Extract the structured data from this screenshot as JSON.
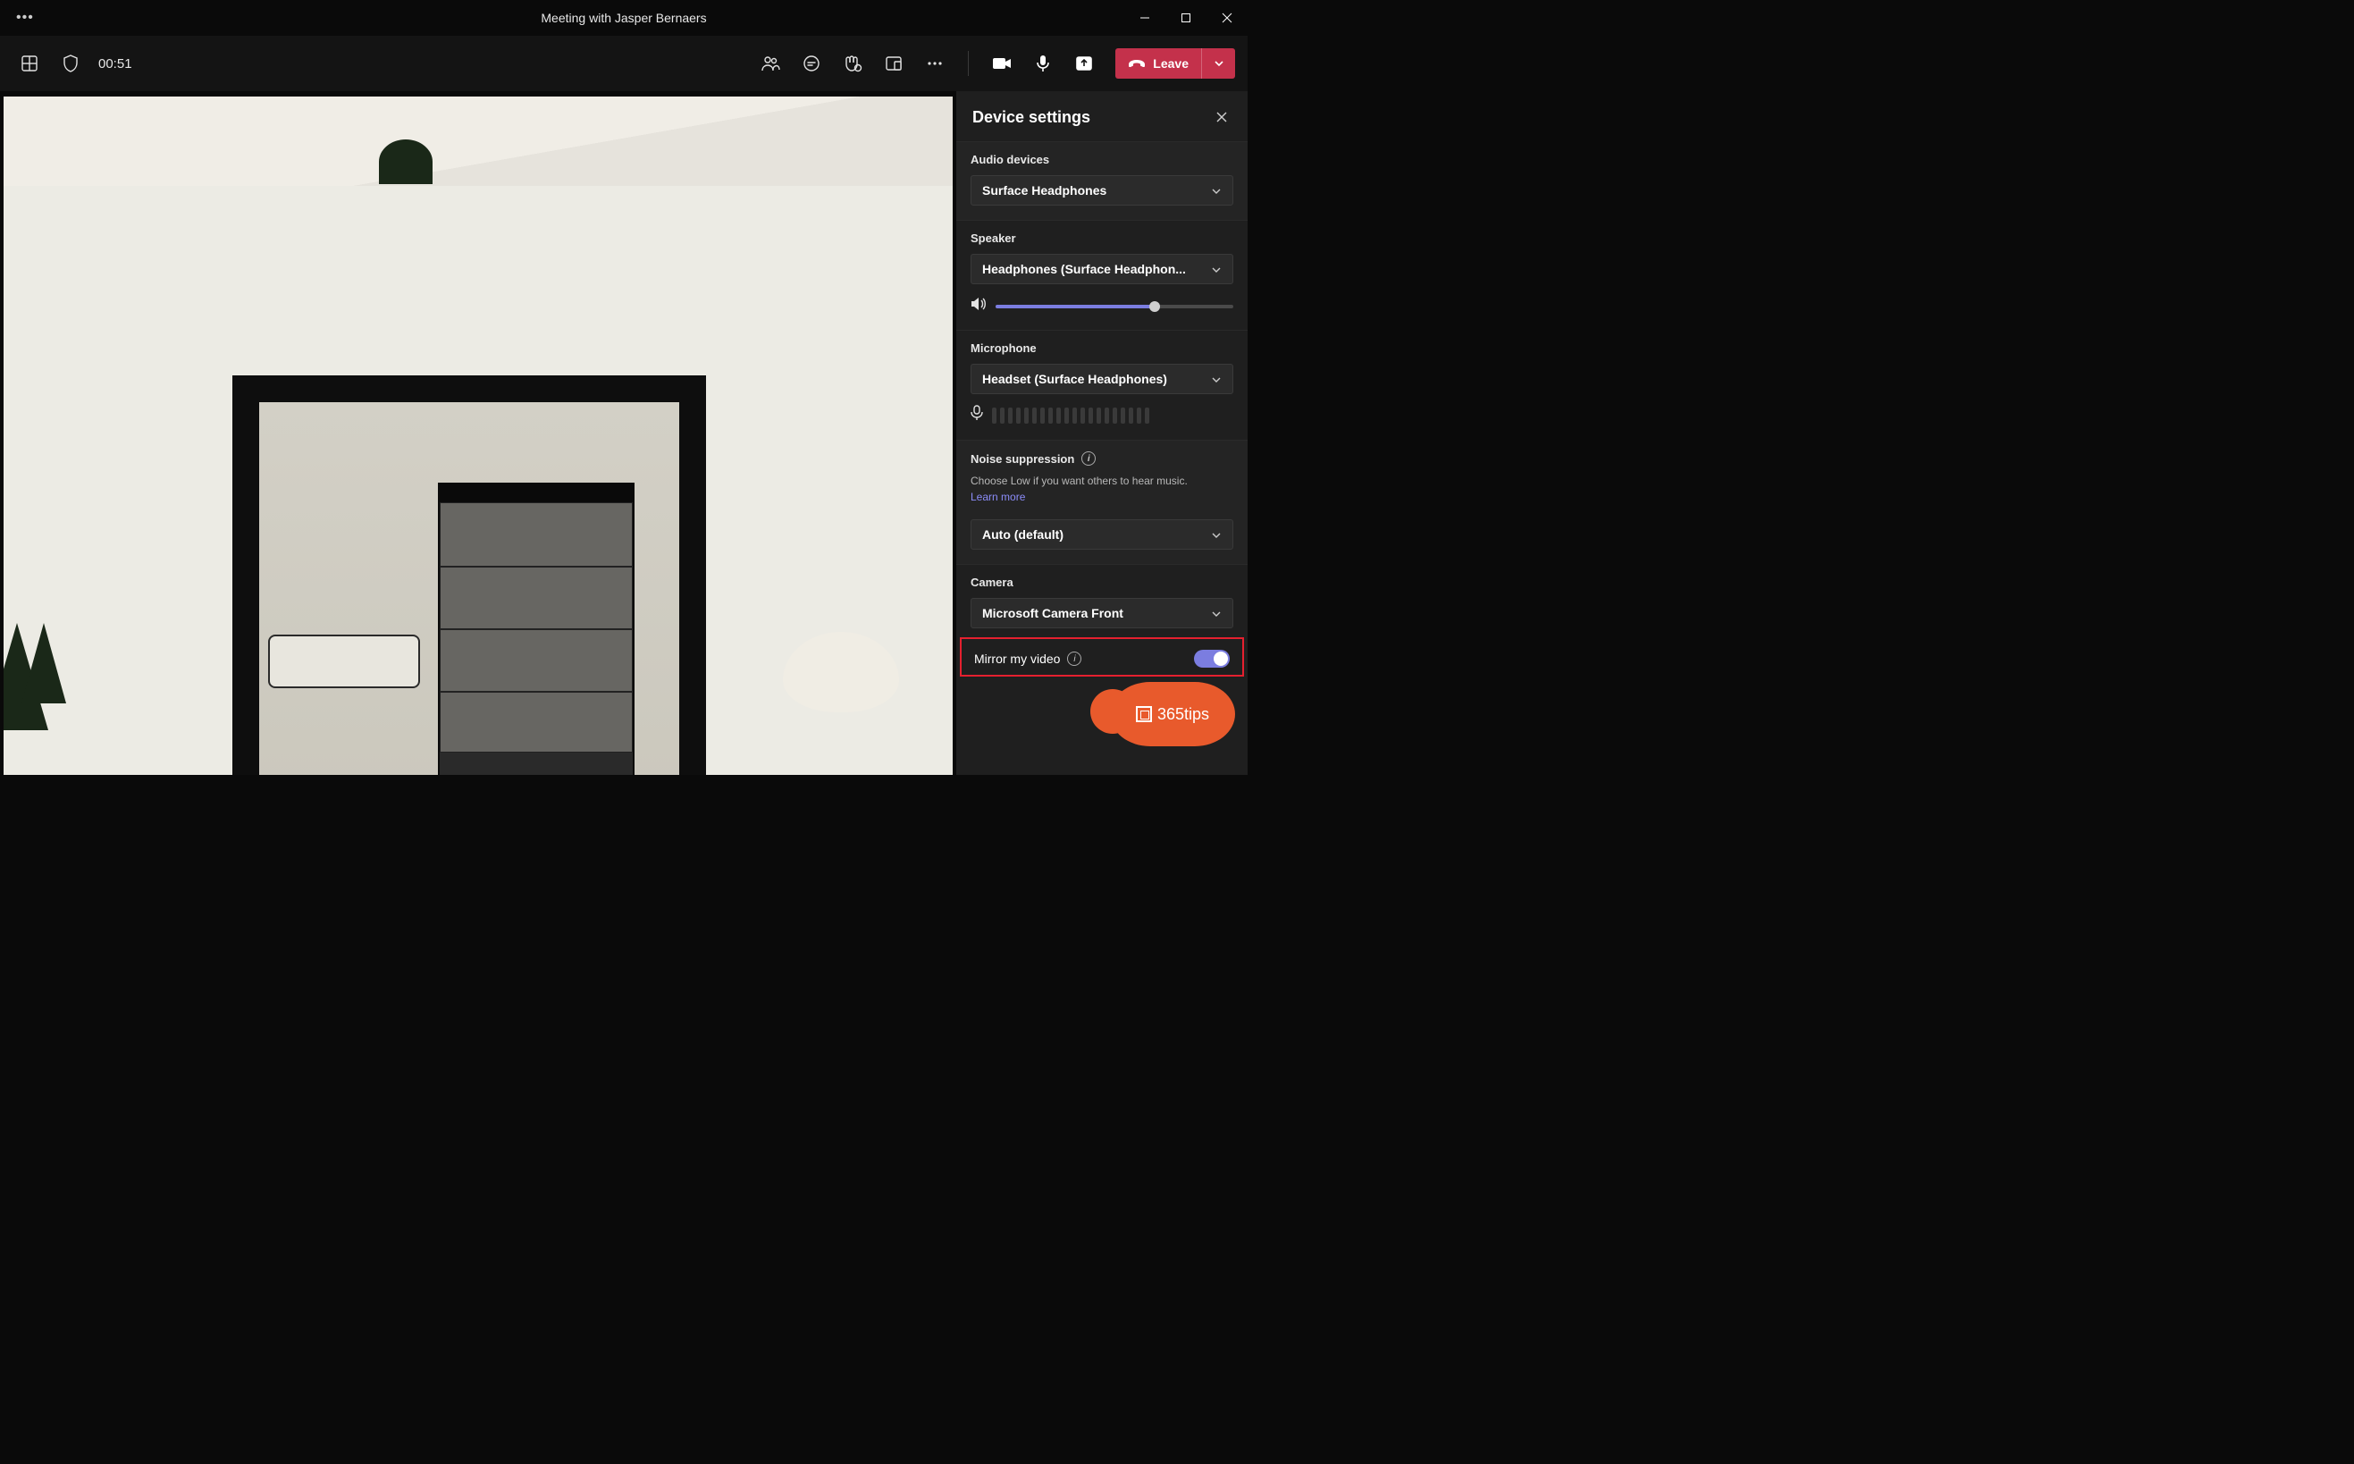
{
  "window": {
    "title": "Meeting with Jasper Bernaers"
  },
  "toolbar": {
    "timer": "00:51",
    "leave_label": "Leave"
  },
  "settings": {
    "title": "Device settings",
    "audio_devices": {
      "label": "Audio devices",
      "selected": "Surface Headphones"
    },
    "speaker": {
      "label": "Speaker",
      "selected": "Headphones (Surface Headphon...",
      "volume_pct": 67
    },
    "microphone": {
      "label": "Microphone",
      "selected": "Headset (Surface Headphones)"
    },
    "noise_suppression": {
      "label": "Noise suppression",
      "desc": "Choose Low if you want others to hear music.",
      "learn_more": "Learn more",
      "selected": "Auto (default)"
    },
    "camera": {
      "label": "Camera",
      "selected": "Microsoft Camera Front"
    },
    "mirror": {
      "label": "Mirror my video",
      "enabled": true
    }
  },
  "badge_text": "365tips"
}
